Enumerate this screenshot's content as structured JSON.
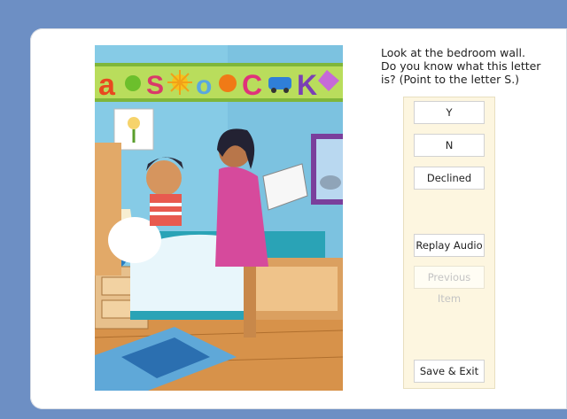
{
  "prompt": {
    "line1": "Look at the bedroom wall.",
    "line2": "Do you know what this letter",
    "line3": "is? (Point to the letter S.)"
  },
  "answers": {
    "yes": "Y",
    "no": "N",
    "declined": "Declined"
  },
  "controls": {
    "replay_audio": "Replay Audio",
    "previous_item": "Previous Item",
    "save_exit": "Save & Exit"
  },
  "illustration": {
    "wall_letters": [
      "a",
      "S",
      "o",
      "C",
      "K"
    ]
  },
  "colors": {
    "page_background": "#6d8fc4",
    "panel_background": "#fdf6e0"
  }
}
